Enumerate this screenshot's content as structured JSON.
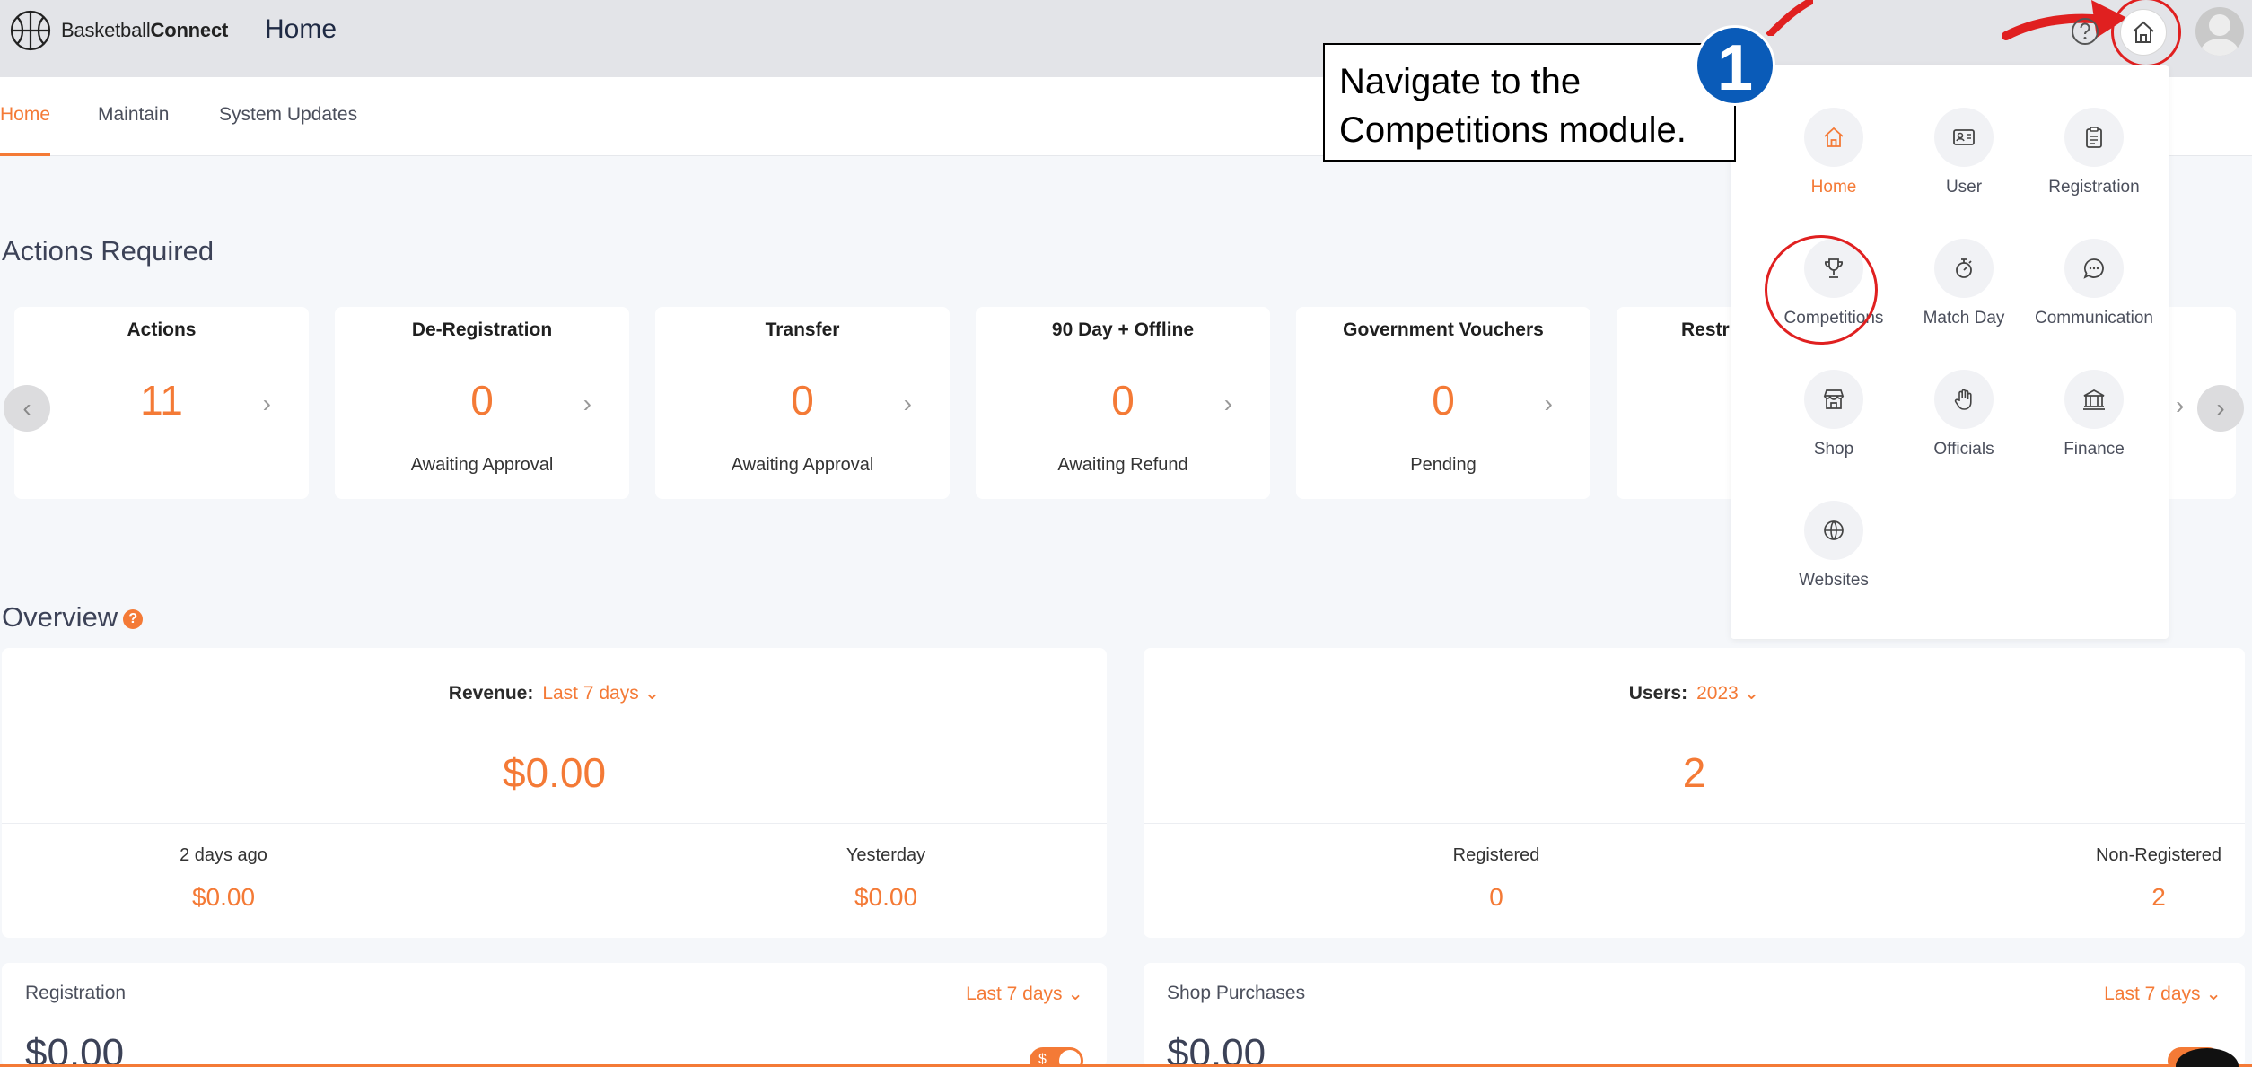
{
  "app": {
    "brand_light": "Basketball",
    "brand_bold": "Connect",
    "page_title": "Home"
  },
  "tabs": [
    {
      "label": "Home"
    },
    {
      "label": "Maintain"
    },
    {
      "label": "System Updates"
    }
  ],
  "actions": {
    "title": "Actions Required",
    "cards": [
      {
        "title": "Actions",
        "value": "11",
        "sub": ""
      },
      {
        "title": "De-Registration",
        "value": "0",
        "sub": "Awaiting Approval"
      },
      {
        "title": "Transfer",
        "value": "0",
        "sub": "Awaiting Approval"
      },
      {
        "title": "90 Day + Offline",
        "value": "0",
        "sub": "Awaiting Refund"
      },
      {
        "title": "Government Vouchers",
        "value": "0",
        "sub": "Pending"
      },
      {
        "title": "Restri",
        "value": "",
        "sub": ""
      }
    ]
  },
  "overview": {
    "title": "Overview",
    "help": "?",
    "revenue": {
      "label": "Revenue:",
      "period": "Last 7 days",
      "total": "$0.00",
      "left_label": "2 days ago",
      "left_value": "$0.00",
      "right_label": "Yesterday",
      "right_value": "$0.00"
    },
    "users": {
      "label": "Users:",
      "period": "2023",
      "total": "2",
      "left_label": "Registered",
      "left_value": "0",
      "right_label": "Non-Registered",
      "right_value": "2"
    }
  },
  "bottom": {
    "registration": {
      "title": "Registration",
      "period": "Last 7 days",
      "value": "$0.00",
      "toggle": "$"
    },
    "shop": {
      "title": "Shop Purchases",
      "period": "Last 7 days",
      "value": "$0.00"
    }
  },
  "menu": {
    "items": [
      {
        "label": "Home",
        "icon": "home-icon"
      },
      {
        "label": "User",
        "icon": "id-card-icon"
      },
      {
        "label": "Registration",
        "icon": "clipboard-icon"
      },
      {
        "label": "Competitions",
        "icon": "trophy-icon"
      },
      {
        "label": "Match Day",
        "icon": "stopwatch-icon"
      },
      {
        "label": "Communication",
        "icon": "chat-icon"
      },
      {
        "label": "Shop",
        "icon": "store-icon"
      },
      {
        "label": "Officials",
        "icon": "hand-icon"
      },
      {
        "label": "Finance",
        "icon": "bank-icon"
      },
      {
        "label": "Websites",
        "icon": "globe-icon"
      }
    ]
  },
  "callout": {
    "line1": "Navigate to the",
    "line2": "Competitions module.",
    "step": "1"
  },
  "colors": {
    "accent": "#f47a36",
    "annotation_red": "#e02020",
    "step_blue": "#0a5bb8"
  }
}
